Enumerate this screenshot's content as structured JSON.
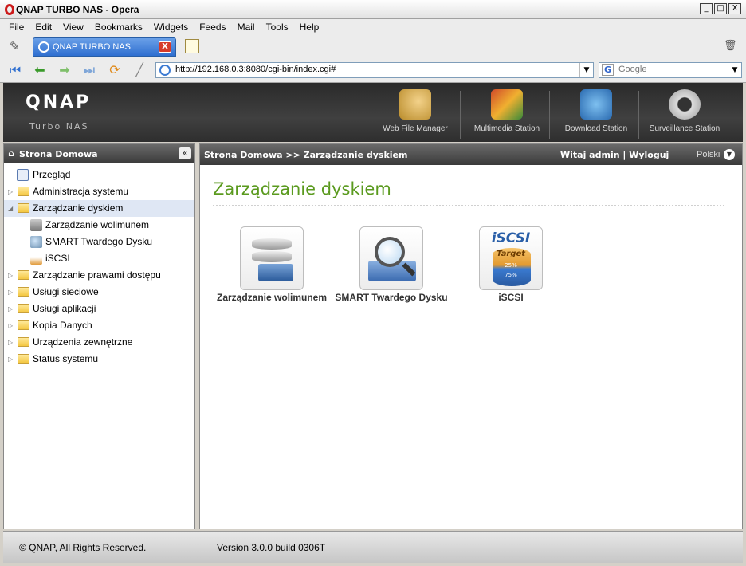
{
  "window": {
    "title": "QNAP TURBO NAS - Opera",
    "controls": [
      "_",
      "□",
      "X"
    ]
  },
  "menu": [
    "File",
    "Edit",
    "View",
    "Bookmarks",
    "Widgets",
    "Feeds",
    "Mail",
    "Tools",
    "Help"
  ],
  "tab": {
    "label": "QNAP TURBO NAS",
    "close": "X"
  },
  "address": {
    "url": "http://192.168.0.3:8080/cgi-bin/index.cgi#",
    "search_placeholder": "Google"
  },
  "nas": {
    "brand": "QNAP",
    "subtitle": "Turbo NAS",
    "apps": [
      "Web File Manager",
      "Multimedia Station",
      "Download Station",
      "Surveillance Station"
    ]
  },
  "sidebar": {
    "title": "Strona Domowa",
    "items": [
      {
        "label": "Przegląd",
        "level": 0
      },
      {
        "label": "Administracja systemu",
        "level": 0
      },
      {
        "label": "Zarządzanie dyskiem",
        "level": 0
      },
      {
        "label": "Zarządzanie wolimunem",
        "level": 1
      },
      {
        "label": "SMART Twardego Dysku",
        "level": 1
      },
      {
        "label": "iSCSI",
        "level": 1
      },
      {
        "label": "Zarządzanie prawami dostępu",
        "level": 0
      },
      {
        "label": "Usługi sieciowe",
        "level": 0
      },
      {
        "label": "Usługi aplikacji",
        "level": 0
      },
      {
        "label": "Kopia Danych",
        "level": 0
      },
      {
        "label": "Urządzenia zewnętrzne",
        "level": 0
      },
      {
        "label": "Status systemu",
        "level": 0
      }
    ]
  },
  "header": {
    "breadcrumb": "Strona Domowa >> Zarządzanie dyskiem",
    "welcome": "Witaj admin | Wyloguj",
    "language": "Polski"
  },
  "main": {
    "title": "Zarządzanie dyskiem",
    "tiles": [
      {
        "label": "Zarządzanie wolimunem"
      },
      {
        "label": "SMART Twardego Dysku"
      },
      {
        "label": "iSCSI",
        "icon_text": "iSCSI",
        "icon_sub": "Target",
        "icon_pct": [
          "25%",
          "75%"
        ]
      }
    ]
  },
  "footer": {
    "copyright": "© QNAP, All Rights Reserved.",
    "version": "Version 3.0.0 build 0306T"
  }
}
